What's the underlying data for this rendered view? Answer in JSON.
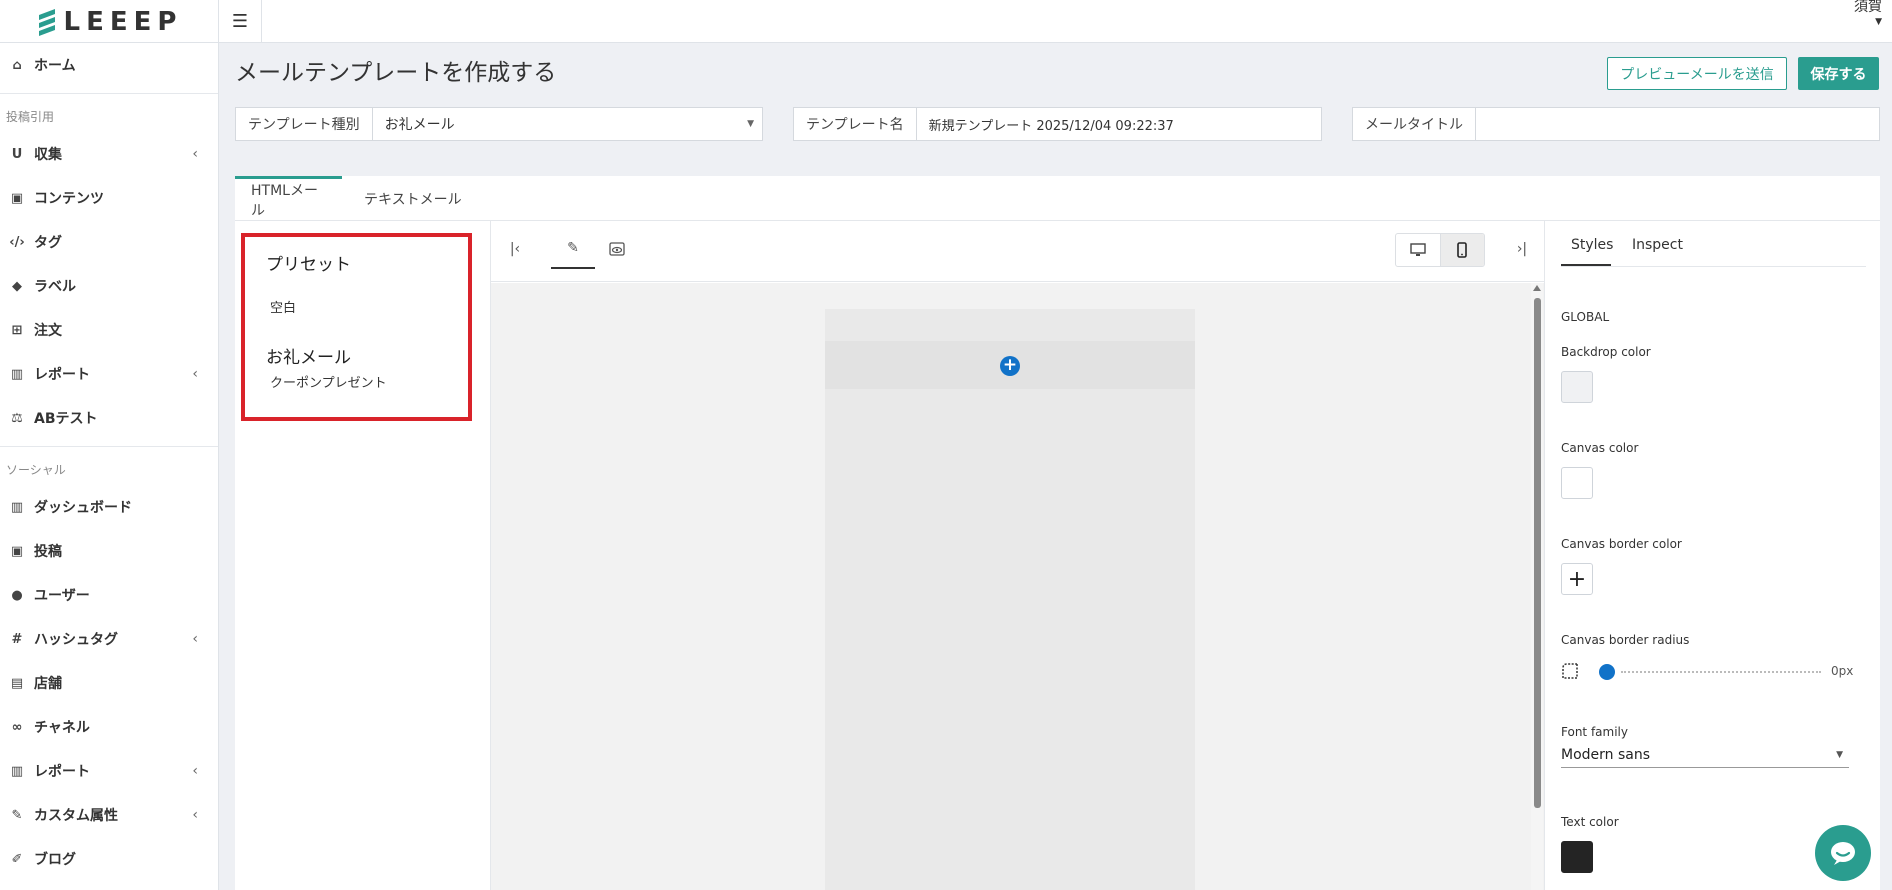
{
  "app": {
    "logo_text": "LEEEP",
    "user_name": "須賀",
    "menu_icon": "hamburger-icon"
  },
  "sidebar": {
    "items": [
      {
        "label": "ホーム",
        "icon": "home-icon"
      },
      {
        "section": "投稿引用"
      },
      {
        "label": "収集",
        "icon": "magnet-icon",
        "chevron": "‹"
      },
      {
        "label": "コンテンツ",
        "icon": "image-icon"
      },
      {
        "label": "タグ",
        "icon": "code-icon"
      },
      {
        "label": "ラベル",
        "icon": "tag-icon"
      },
      {
        "label": "注文",
        "icon": "cart-icon"
      },
      {
        "label": "レポート",
        "icon": "bar-chart-icon",
        "chevron": "‹"
      },
      {
        "label": "ABテスト",
        "icon": "balance-scale-icon"
      },
      {
        "section": "ソーシャル"
      },
      {
        "label": "ダッシュボード",
        "icon": "bar-chart-icon"
      },
      {
        "label": "投稿",
        "icon": "image-icon"
      },
      {
        "label": "ユーザー",
        "icon": "users-icon"
      },
      {
        "label": "ハッシュタグ",
        "icon": "hash-icon",
        "chevron": "‹"
      },
      {
        "label": "店舗",
        "icon": "building-icon"
      },
      {
        "label": "チャネル",
        "icon": "link-icon"
      },
      {
        "label": "レポート",
        "icon": "bar-chart-icon",
        "chevron": "‹"
      },
      {
        "label": "カスタム属性",
        "icon": "wrench-icon",
        "chevron": "‹"
      },
      {
        "label": "ブログ",
        "icon": "pencil-icon"
      }
    ]
  },
  "page": {
    "title": "メールテンプレートを作成する",
    "preview_button": "プレビューメールを送信",
    "save_button": "保存する"
  },
  "fields": {
    "template_type": {
      "label": "テンプレート種別",
      "value": "お礼メール"
    },
    "template_name": {
      "label": "テンプレート名",
      "value": "新規テンプレート 2025/12/04 09:22:37"
    },
    "mail_title": {
      "label": "メールタイトル",
      "value": ""
    }
  },
  "tabs": {
    "html": "HTMLメール",
    "text": "テキストメール"
  },
  "presets": {
    "heading": "プリセット",
    "blank": "空白",
    "group": "お礼メール",
    "coupon": "クーポンプレゼント"
  },
  "toolbar": {
    "collapse_left_icon": "collapse-left-icon",
    "edit_icon": "pencil-icon",
    "preview_icon": "eye-icon",
    "desktop_icon": "desktop-icon",
    "mobile_icon": "mobile-icon",
    "collapse_right_icon": "collapse-right-icon"
  },
  "panel": {
    "tab_styles": "Styles",
    "tab_inspect": "Inspect",
    "global": "GLOBAL",
    "backdrop_color": "Backdrop color",
    "canvas_color": "Canvas color",
    "canvas_border_color": "Canvas border color",
    "canvas_border_radius": "Canvas border radius",
    "radius_value": "0px",
    "font_family": "Font family",
    "font_family_value": "Modern sans",
    "text_color": "Text color"
  },
  "colors": {
    "accent": "#2a9d8f",
    "highlight_border": "#d9232a",
    "add_button": "#1172c8",
    "backdrop_swatch": "#f0f1f3",
    "canvas_swatch": "#ffffff",
    "text_swatch": "#242424"
  }
}
